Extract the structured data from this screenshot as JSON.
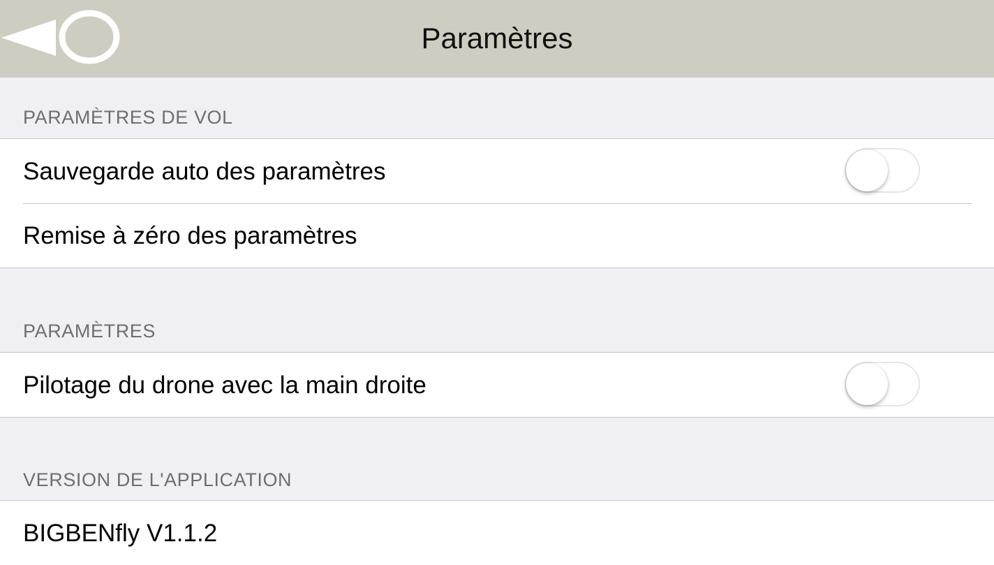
{
  "navbar": {
    "title": "Paramètres",
    "back_icon": "back-triangle-circle-icon"
  },
  "sections": [
    {
      "header": "PARAMÈTRES DE VOL",
      "cells": [
        {
          "label": "Sauvegarde auto des paramètres",
          "control": "toggle",
          "on": false
        },
        {
          "label": "Remise à zéro des paramètres",
          "control": "none"
        }
      ]
    },
    {
      "header": "PARAMÈTRES",
      "cells": [
        {
          "label": "Pilotage du drone avec la main droite",
          "control": "toggle",
          "on": false
        }
      ]
    },
    {
      "header": "VERSION DE L'APPLICATION",
      "cells": [
        {
          "label": "BIGBENfly V1.1.2",
          "control": "none"
        }
      ]
    }
  ],
  "colors": {
    "navbar_bg": "#cdcdc2",
    "page_bg": "#efeff4",
    "header_text": "#6d6d72",
    "separator": "#c8c7cc"
  }
}
